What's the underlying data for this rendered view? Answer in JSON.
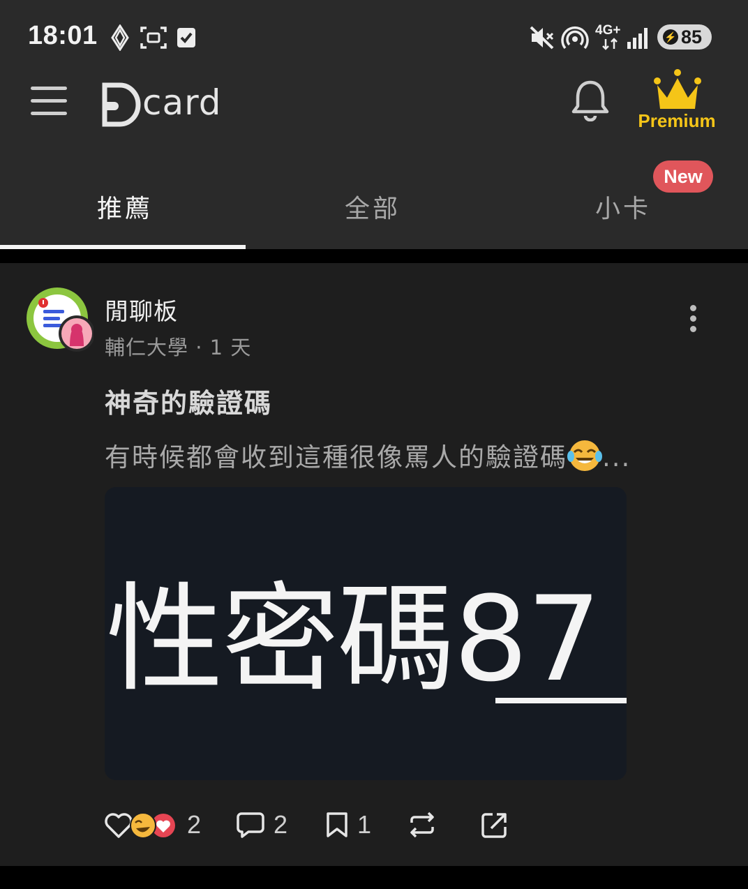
{
  "status_bar": {
    "time": "18:01",
    "network": "4G+",
    "battery": "85",
    "icons": [
      "vpn-icon",
      "screenshot-icon",
      "checkbox-icon",
      "mute-icon",
      "hotspot-icon",
      "signal-icon",
      "battery-icon"
    ]
  },
  "header": {
    "logo_text": "card",
    "premium_label": "Premium",
    "icons": [
      "menu-icon",
      "bell-icon",
      "crown-icon"
    ]
  },
  "tabs": [
    {
      "label": "推薦",
      "active": true
    },
    {
      "label": "全部",
      "active": false
    },
    {
      "label": "小卡",
      "active": false,
      "badge": "New"
    }
  ],
  "post": {
    "forum": "閒聊板",
    "school": "輔仁大學",
    "time": "1 天",
    "title": "神奇的驗證碼",
    "excerpt": "有時候都會收到這種很像罵人的驗證碼",
    "ellipsis": "...",
    "image_text": "性密碼87",
    "likes": "2",
    "comments": "2",
    "bookmarks": "1"
  },
  "colors": {
    "background": "#1e1e1e",
    "header": "#2a2a2a",
    "premium": "#f5c518",
    "badge": "#e0565b"
  }
}
